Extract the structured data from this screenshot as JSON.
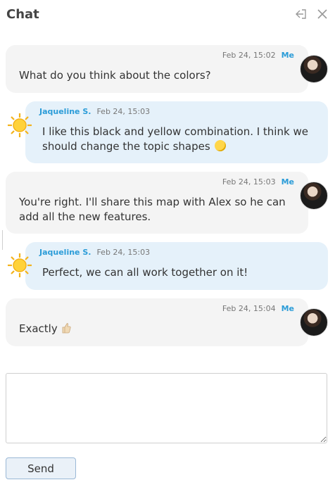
{
  "header": {
    "title": "Chat"
  },
  "messages": [
    {
      "sender": "Me",
      "time": "Feb 24, 15:02",
      "text": "What do you think about the colors?"
    },
    {
      "sender": "Jaqueline S.",
      "time": "Feb 24, 15:03",
      "text": "I like this black and yellow combination. I think we should change the topic shapes"
    },
    {
      "sender": "Me",
      "time": "Feb 24, 15:03",
      "text": "You're right. I'll share this map with Alex so he can add all the new features."
    },
    {
      "sender": "Jaqueline S.",
      "time": "Feb 24, 15:03",
      "text": "Perfect, we can all work together on it!"
    },
    {
      "sender": "Me",
      "time": "Feb 24, 15:04",
      "text": "Exactly"
    }
  ],
  "composer": {
    "placeholder": "",
    "value": "",
    "send_label": "Send"
  },
  "colors": {
    "accent": "#2b9cd8",
    "my_bubble": "#f4f4f4",
    "their_bubble": "#e5f1fa"
  }
}
